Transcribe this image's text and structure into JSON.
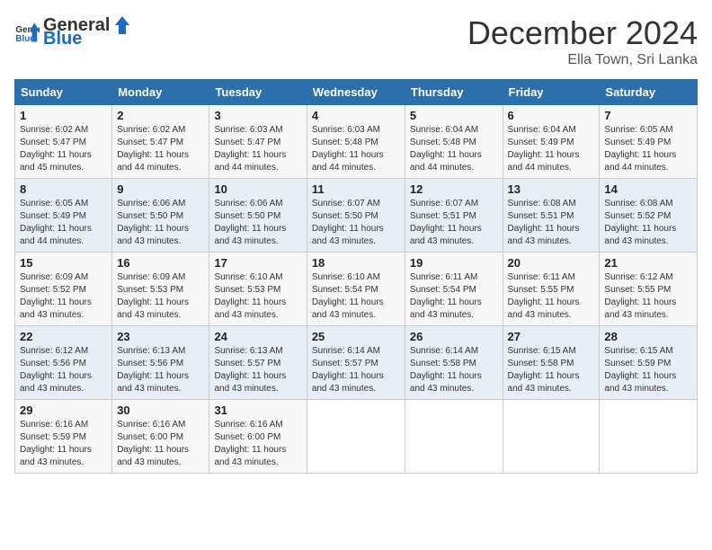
{
  "header": {
    "logo_general": "General",
    "logo_blue": "Blue",
    "month": "December 2024",
    "location": "Ella Town, Sri Lanka"
  },
  "days_of_week": [
    "Sunday",
    "Monday",
    "Tuesday",
    "Wednesday",
    "Thursday",
    "Friday",
    "Saturday"
  ],
  "weeks": [
    [
      {
        "day": "1",
        "sunrise": "Sunrise: 6:02 AM",
        "sunset": "Sunset: 5:47 PM",
        "daylight": "Daylight: 11 hours and 45 minutes."
      },
      {
        "day": "2",
        "sunrise": "Sunrise: 6:02 AM",
        "sunset": "Sunset: 5:47 PM",
        "daylight": "Daylight: 11 hours and 44 minutes."
      },
      {
        "day": "3",
        "sunrise": "Sunrise: 6:03 AM",
        "sunset": "Sunset: 5:47 PM",
        "daylight": "Daylight: 11 hours and 44 minutes."
      },
      {
        "day": "4",
        "sunrise": "Sunrise: 6:03 AM",
        "sunset": "Sunset: 5:48 PM",
        "daylight": "Daylight: 11 hours and 44 minutes."
      },
      {
        "day": "5",
        "sunrise": "Sunrise: 6:04 AM",
        "sunset": "Sunset: 5:48 PM",
        "daylight": "Daylight: 11 hours and 44 minutes."
      },
      {
        "day": "6",
        "sunrise": "Sunrise: 6:04 AM",
        "sunset": "Sunset: 5:49 PM",
        "daylight": "Daylight: 11 hours and 44 minutes."
      },
      {
        "day": "7",
        "sunrise": "Sunrise: 6:05 AM",
        "sunset": "Sunset: 5:49 PM",
        "daylight": "Daylight: 11 hours and 44 minutes."
      }
    ],
    [
      {
        "day": "8",
        "sunrise": "Sunrise: 6:05 AM",
        "sunset": "Sunset: 5:49 PM",
        "daylight": "Daylight: 11 hours and 44 minutes."
      },
      {
        "day": "9",
        "sunrise": "Sunrise: 6:06 AM",
        "sunset": "Sunset: 5:50 PM",
        "daylight": "Daylight: 11 hours and 43 minutes."
      },
      {
        "day": "10",
        "sunrise": "Sunrise: 6:06 AM",
        "sunset": "Sunset: 5:50 PM",
        "daylight": "Daylight: 11 hours and 43 minutes."
      },
      {
        "day": "11",
        "sunrise": "Sunrise: 6:07 AM",
        "sunset": "Sunset: 5:50 PM",
        "daylight": "Daylight: 11 hours and 43 minutes."
      },
      {
        "day": "12",
        "sunrise": "Sunrise: 6:07 AM",
        "sunset": "Sunset: 5:51 PM",
        "daylight": "Daylight: 11 hours and 43 minutes."
      },
      {
        "day": "13",
        "sunrise": "Sunrise: 6:08 AM",
        "sunset": "Sunset: 5:51 PM",
        "daylight": "Daylight: 11 hours and 43 minutes."
      },
      {
        "day": "14",
        "sunrise": "Sunrise: 6:08 AM",
        "sunset": "Sunset: 5:52 PM",
        "daylight": "Daylight: 11 hours and 43 minutes."
      }
    ],
    [
      {
        "day": "15",
        "sunrise": "Sunrise: 6:09 AM",
        "sunset": "Sunset: 5:52 PM",
        "daylight": "Daylight: 11 hours and 43 minutes."
      },
      {
        "day": "16",
        "sunrise": "Sunrise: 6:09 AM",
        "sunset": "Sunset: 5:53 PM",
        "daylight": "Daylight: 11 hours and 43 minutes."
      },
      {
        "day": "17",
        "sunrise": "Sunrise: 6:10 AM",
        "sunset": "Sunset: 5:53 PM",
        "daylight": "Daylight: 11 hours and 43 minutes."
      },
      {
        "day": "18",
        "sunrise": "Sunrise: 6:10 AM",
        "sunset": "Sunset: 5:54 PM",
        "daylight": "Daylight: 11 hours and 43 minutes."
      },
      {
        "day": "19",
        "sunrise": "Sunrise: 6:11 AM",
        "sunset": "Sunset: 5:54 PM",
        "daylight": "Daylight: 11 hours and 43 minutes."
      },
      {
        "day": "20",
        "sunrise": "Sunrise: 6:11 AM",
        "sunset": "Sunset: 5:55 PM",
        "daylight": "Daylight: 11 hours and 43 minutes."
      },
      {
        "day": "21",
        "sunrise": "Sunrise: 6:12 AM",
        "sunset": "Sunset: 5:55 PM",
        "daylight": "Daylight: 11 hours and 43 minutes."
      }
    ],
    [
      {
        "day": "22",
        "sunrise": "Sunrise: 6:12 AM",
        "sunset": "Sunset: 5:56 PM",
        "daylight": "Daylight: 11 hours and 43 minutes."
      },
      {
        "day": "23",
        "sunrise": "Sunrise: 6:13 AM",
        "sunset": "Sunset: 5:56 PM",
        "daylight": "Daylight: 11 hours and 43 minutes."
      },
      {
        "day": "24",
        "sunrise": "Sunrise: 6:13 AM",
        "sunset": "Sunset: 5:57 PM",
        "daylight": "Daylight: 11 hours and 43 minutes."
      },
      {
        "day": "25",
        "sunrise": "Sunrise: 6:14 AM",
        "sunset": "Sunset: 5:57 PM",
        "daylight": "Daylight: 11 hours and 43 minutes."
      },
      {
        "day": "26",
        "sunrise": "Sunrise: 6:14 AM",
        "sunset": "Sunset: 5:58 PM",
        "daylight": "Daylight: 11 hours and 43 minutes."
      },
      {
        "day": "27",
        "sunrise": "Sunrise: 6:15 AM",
        "sunset": "Sunset: 5:58 PM",
        "daylight": "Daylight: 11 hours and 43 minutes."
      },
      {
        "day": "28",
        "sunrise": "Sunrise: 6:15 AM",
        "sunset": "Sunset: 5:59 PM",
        "daylight": "Daylight: 11 hours and 43 minutes."
      }
    ],
    [
      {
        "day": "29",
        "sunrise": "Sunrise: 6:16 AM",
        "sunset": "Sunset: 5:59 PM",
        "daylight": "Daylight: 11 hours and 43 minutes."
      },
      {
        "day": "30",
        "sunrise": "Sunrise: 6:16 AM",
        "sunset": "Sunset: 6:00 PM",
        "daylight": "Daylight: 11 hours and 43 minutes."
      },
      {
        "day": "31",
        "sunrise": "Sunrise: 6:16 AM",
        "sunset": "Sunset: 6:00 PM",
        "daylight": "Daylight: 11 hours and 43 minutes."
      },
      null,
      null,
      null,
      null
    ]
  ]
}
